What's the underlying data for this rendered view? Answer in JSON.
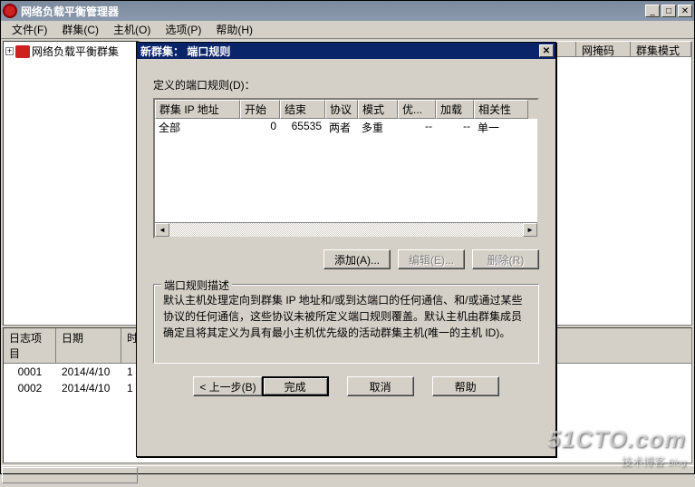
{
  "main": {
    "title": "网络负载平衡管理器",
    "menu": [
      "文件(F)",
      "群集(C)",
      "主机(O)",
      "选项(P)",
      "帮助(H)"
    ],
    "tree_root": "网络负载平衡群集",
    "right_headers": [
      "网掩码",
      "群集模式"
    ],
    "log_headers": [
      "日志项目",
      "日期",
      "时"
    ],
    "log_rows": [
      {
        "id": "0001",
        "date": "2014/4/10",
        "t": "1"
      },
      {
        "id": "0002",
        "date": "2014/4/10",
        "t": "1"
      }
    ]
  },
  "dialog": {
    "title": "新群集：  端口规则",
    "defined_label": "定义的端口规则(D)：",
    "grid": {
      "headers": [
        "群集 IP 地址",
        "开始",
        "结束",
        "协议",
        "模式",
        "优...",
        "加载",
        "相关性"
      ],
      "row": {
        "ip": "全部",
        "start": "0",
        "end": "65535",
        "proto": "两者",
        "mode": "多重",
        "pri": "--",
        "load": "--",
        "aff": "单一"
      }
    },
    "buttons": {
      "add": "添加(A)...",
      "edit": "编辑(E)...",
      "remove": "删除(R)"
    },
    "group_title": "端口规则描述",
    "desc": "默认主机处理定向到群集 IP 地址和/或到达端口的任何通信、和/或通过某些协议的任何通信，这些协议未被所定义端口规则覆盖。默认主机由群集成员确定且将其定义为具有最小主机优先级的活动群集主机(唯一的主机 ID)。",
    "wizard": {
      "back": "< 上一步(B)",
      "finish": "完成",
      "cancel": "取消",
      "help": "帮助"
    }
  },
  "watermark": {
    "line1": "51CTO.com",
    "line2": "技术博客",
    "blog": "Blog"
  }
}
